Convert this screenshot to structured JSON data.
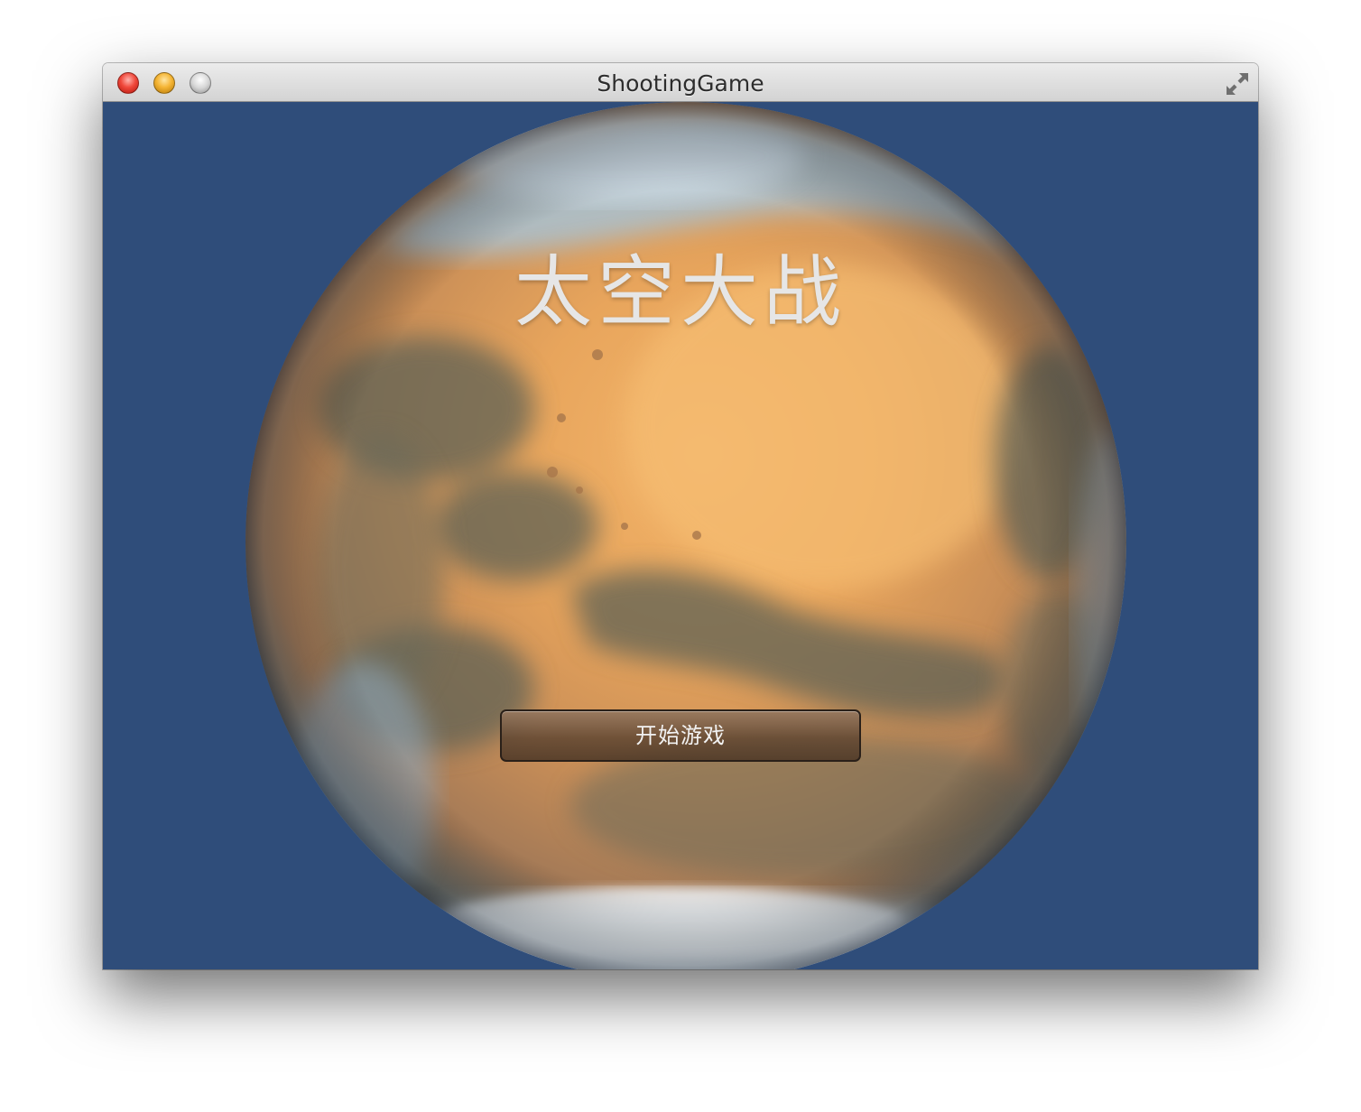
{
  "window": {
    "title": "ShootingGame",
    "background_color": "#2f4d7a"
  },
  "titlebar": {
    "buttons": [
      "close-button",
      "minimize-button",
      "zoom-button"
    ],
    "fullscreen_icon": "fullscreen-arrows-icon"
  },
  "game": {
    "title": "太空大战",
    "start_button_label": "开始游戏",
    "background_image": "mars-planet"
  }
}
